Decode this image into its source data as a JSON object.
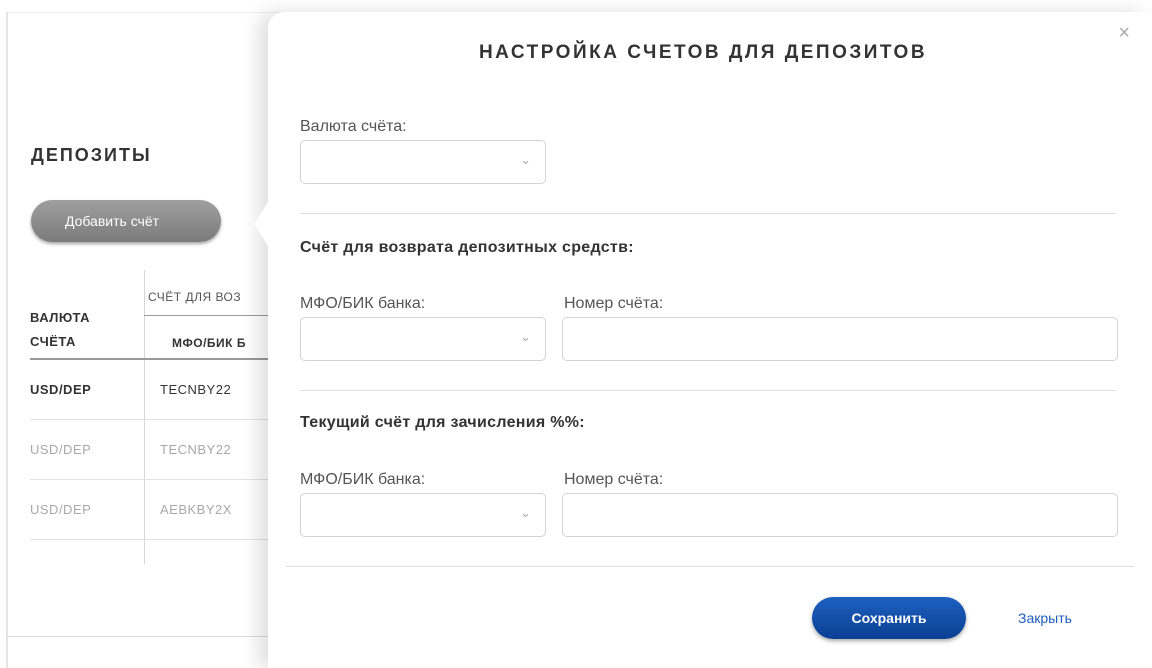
{
  "background": {
    "title": "ДЕПОЗИТЫ",
    "add_button_label": "Добавить счёт",
    "table": {
      "col_currency_line1": "ВАЛЮТА",
      "col_currency_line2": "СЧЁТА",
      "col_account_group": "СЧЁТ ДЛЯ ВОЗ",
      "col_mfo": "МФО/БИК Б",
      "rows": [
        {
          "currency": "USD/DEP",
          "mfo": "TECNBY22"
        },
        {
          "currency": "USD/DEP",
          "mfo": "TECNBY22"
        },
        {
          "currency": "USD/DEP",
          "mfo": "AEBKBY2X"
        }
      ]
    }
  },
  "modal": {
    "title": "НАСТРОЙКА СЧЕТОВ ДЛЯ ДЕПОЗИТОВ",
    "close_icon": "×",
    "currency_label": "Валюта счёта:",
    "currency_value": "",
    "return_section_title": "Счёт для возврата депозитных средств:",
    "return_mfo_label": "МФО/БИК банка:",
    "return_account_label": "Номер счёта:",
    "interest_section_title": "Текущий счёт для зачисления %%:",
    "interest_mfo_label": "МФО/БИК банка:",
    "interest_account_label": "Номер счёта:",
    "chevron_icon": "⌄",
    "save_label": "Сохранить",
    "close_label": "Закрыть"
  }
}
